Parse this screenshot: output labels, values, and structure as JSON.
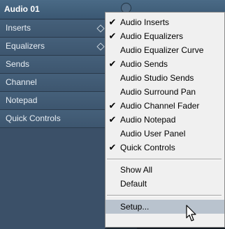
{
  "inspector": {
    "track_name": "Audio 01",
    "sections": [
      {
        "label": "Inserts",
        "has_diamond": true
      },
      {
        "label": "Equalizers",
        "has_diamond": true
      },
      {
        "label": "Sends",
        "has_diamond": false
      },
      {
        "label": "Channel",
        "has_diamond": false
      },
      {
        "label": "Notepad",
        "has_diamond": false
      },
      {
        "label": "Quick Controls",
        "has_diamond": false
      }
    ]
  },
  "context_menu": {
    "items": [
      {
        "label": "Audio Inserts",
        "checked": true
      },
      {
        "label": "Audio Equalizers",
        "checked": true
      },
      {
        "label": "Audio Equalizer Curve",
        "checked": false
      },
      {
        "label": "Audio Sends",
        "checked": true
      },
      {
        "label": "Audio Studio Sends",
        "checked": false
      },
      {
        "label": "Audio Surround Pan",
        "checked": false
      },
      {
        "label": "Audio Channel Fader",
        "checked": true
      },
      {
        "label": "Audio Notepad",
        "checked": true
      },
      {
        "label": "Audio User Panel",
        "checked": false
      },
      {
        "label": "Quick Controls",
        "checked": true
      }
    ],
    "show_all_label": "Show All",
    "default_label": "Default",
    "setup_label": "Setup...",
    "highlighted_item": "Setup...",
    "check_glyph": "✔"
  },
  "colors": {
    "menu_bg": "#f0f0f0",
    "menu_highlight": "#b9c3ce",
    "inspector_bg": "#3d566f"
  }
}
